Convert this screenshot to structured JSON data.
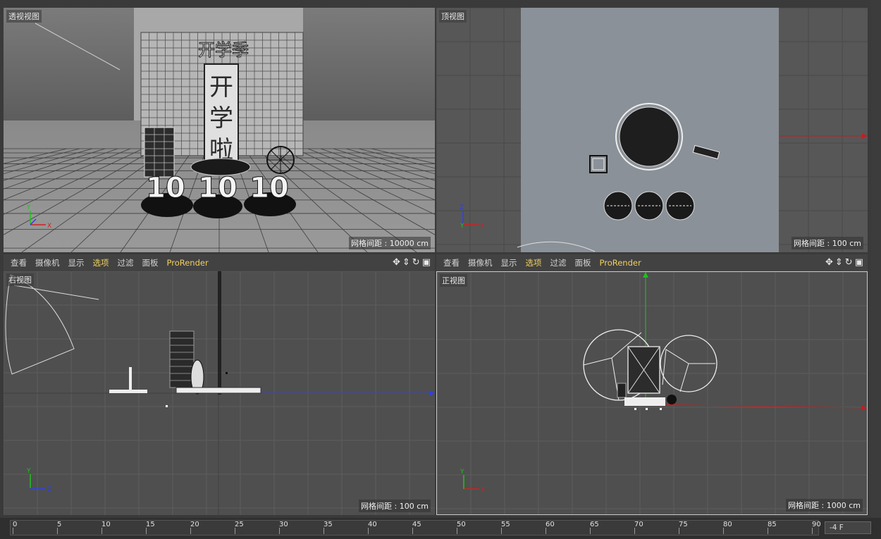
{
  "menu": {
    "items": [
      "查看",
      "摄像机",
      "显示",
      "选项",
      "过滤",
      "面板",
      "ProRender"
    ],
    "selected": "选项"
  },
  "viewports": {
    "perspective": {
      "label": "透视视图",
      "grid": "网格间距 : 10000 cm"
    },
    "top": {
      "label": "顶视图",
      "grid": "网格间距 : 100 cm"
    },
    "right": {
      "label": "右视图",
      "grid": "网格间距 : 100 cm"
    },
    "front": {
      "label": "正视图",
      "grid": "网格间距 : 1000 cm"
    }
  },
  "scene_text": {
    "header": "开学季",
    "c1": "开",
    "c2": "学",
    "c3": "啦",
    "num": "10"
  },
  "axes": {
    "x": "X",
    "y": "Y",
    "z": "Z"
  },
  "timeline": {
    "ticks": [
      "0",
      "5",
      "10",
      "15",
      "20",
      "25",
      "30",
      "35",
      "40",
      "45",
      "50",
      "55",
      "60",
      "65",
      "70",
      "75",
      "80",
      "85",
      "90"
    ],
    "frame": "-4 F"
  },
  "colors": {
    "accent": "#f0d060",
    "viewport_bg": "#4f4f4f",
    "axis_x": "#d02020",
    "axis_y": "#20c020",
    "axis_z": "#3040e0"
  }
}
